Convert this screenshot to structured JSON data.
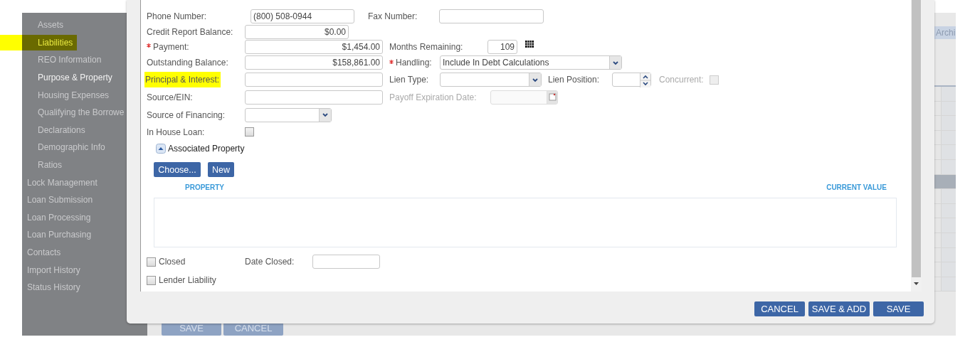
{
  "sidebar": {
    "sub_items": [
      {
        "label": "Assets",
        "selected": false,
        "highlighted": false
      },
      {
        "label": "Liabilities",
        "selected": false,
        "highlighted": true
      },
      {
        "label": "REO Information",
        "selected": false,
        "highlighted": false
      },
      {
        "label": "Purpose & Property",
        "selected": true,
        "highlighted": false
      },
      {
        "label": "Housing Expenses",
        "selected": false,
        "highlighted": false
      },
      {
        "label": "Qualifying the Borrowe",
        "selected": false,
        "highlighted": false
      },
      {
        "label": "Declarations",
        "selected": false,
        "highlighted": false
      },
      {
        "label": "Demographic Info",
        "selected": false,
        "highlighted": false
      },
      {
        "label": "Ratios",
        "selected": false,
        "highlighted": false
      }
    ],
    "items": [
      {
        "label": "Lock Management",
        "selected": false,
        "highlighted": false
      },
      {
        "label": "Loan Submission",
        "selected": false,
        "highlighted": false
      },
      {
        "label": "Loan Processing",
        "selected": false,
        "highlighted": false
      },
      {
        "label": "Loan Purchasing",
        "selected": false,
        "highlighted": false
      },
      {
        "label": "Contacts",
        "selected": false,
        "highlighted": false
      },
      {
        "label": "Import History",
        "selected": false,
        "highlighted": false
      },
      {
        "label": "Status History",
        "selected": false,
        "highlighted": false
      }
    ]
  },
  "page": {
    "tab": "Archi",
    "buttons": [
      "SAVE",
      "CANCEL"
    ]
  },
  "dialog": {
    "form": {
      "rows": [
        [
          {
            "label": "Phone Number:",
            "kind": "text",
            "value": "(800) 508-0944",
            "required": false,
            "disabled": false,
            "highlighted": false
          },
          {
            "label": "Fax Number:",
            "kind": "text",
            "required": false,
            "disabled": false,
            "highlighted": false
          }
        ],
        [
          {
            "label": "Credit Report Balance:",
            "kind": "amount",
            "value": "$0.00",
            "required": false,
            "disabled": false,
            "highlighted": false
          }
        ],
        [
          {
            "label": "Payment:",
            "kind": "amount",
            "value": "$1,454.00",
            "required": true,
            "disabled": false,
            "highlighted": false
          },
          {
            "label": "Months Remaining:",
            "kind": "amount",
            "value": "109",
            "required": false,
            "disabled": false,
            "highlighted": false
          },
          {
            "kind": "grid"
          }
        ],
        [
          {
            "label": "Outstanding Balance:",
            "kind": "amount",
            "value": "$158,861.00",
            "required": false,
            "disabled": false,
            "highlighted": false
          },
          {
            "label": "Handling:",
            "kind": "select",
            "value": "Include In Debt Calculations",
            "required": true,
            "disabled": false,
            "highlighted": false
          }
        ],
        [
          {
            "label": "Principal & Interest:",
            "kind": "amount",
            "required": false,
            "disabled": false,
            "highlighted": true
          },
          {
            "label": "Lien Type:",
            "kind": "select",
            "required": false,
            "disabled": false,
            "highlighted": false
          },
          {
            "label": "Lien Position:",
            "kind": "spinner",
            "required": false,
            "disabled": false,
            "highlighted": false
          },
          {
            "label": "Concurrent:",
            "kind": "checkbox",
            "checked": false,
            "required": false,
            "disabled": true,
            "highlighted": false
          }
        ],
        [
          {
            "label": "Source/EIN:",
            "kind": "text",
            "required": false,
            "disabled": false,
            "highlighted": false
          },
          {
            "label": "Payoff Expiration Date:",
            "kind": "date",
            "required": false,
            "disabled": true,
            "highlighted": false
          }
        ],
        [
          {
            "label": "Source of Financing:",
            "kind": "select",
            "required": false,
            "disabled": false,
            "highlighted": false
          }
        ],
        [
          {
            "label": "In House Loan:",
            "kind": "checkbox",
            "checked": false,
            "required": false,
            "disabled": false,
            "highlighted": false
          }
        ]
      ]
    },
    "associated_property": {
      "label": "Associated Property",
      "expanded": true,
      "buttons": [
        "Choose...",
        "New"
      ],
      "table": {
        "columns": [
          "PROPERTY",
          "CURRENT VALUE"
        ]
      }
    },
    "closed": {
      "label": "Closed",
      "checked": false
    },
    "date_closed": {
      "label": "Date Closed:"
    },
    "lender_liability": {
      "label": "Lender Liability",
      "checked": false
    },
    "buttons": [
      "CANCEL",
      "SAVE & ADD",
      "SAVE"
    ]
  }
}
